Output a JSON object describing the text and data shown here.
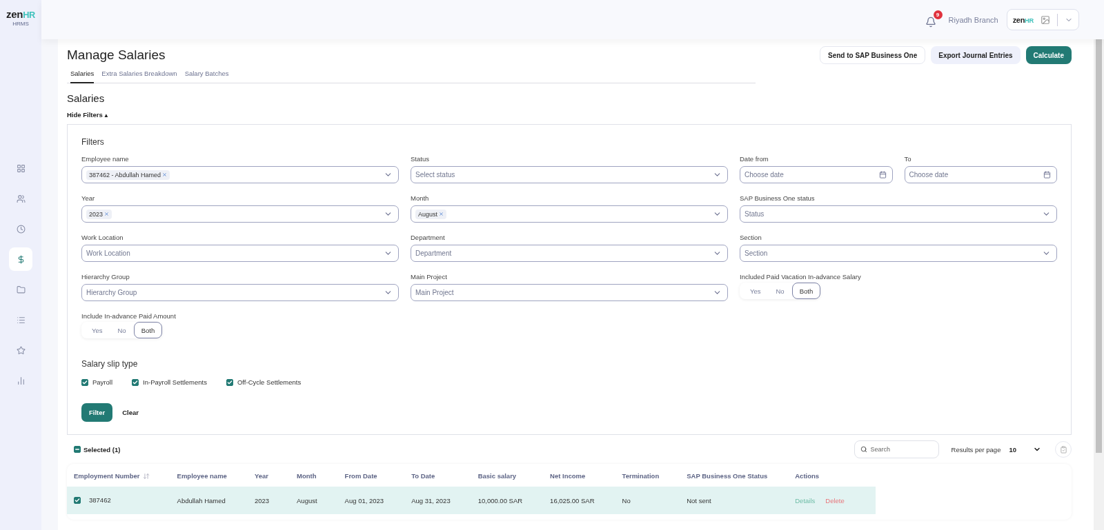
{
  "brand": {
    "logo_main": "zen",
    "logo_accent": "HR",
    "subtitle": "HRMS"
  },
  "sidebar": {
    "items": [
      {
        "kind": "grid",
        "selected": false
      },
      {
        "kind": "users",
        "selected": false
      },
      {
        "kind": "clock",
        "selected": false
      },
      {
        "kind": "dollar",
        "selected": true
      },
      {
        "kind": "folder",
        "selected": false
      },
      {
        "kind": "list",
        "selected": false
      },
      {
        "kind": "star",
        "selected": false
      },
      {
        "kind": "chart",
        "selected": false
      }
    ]
  },
  "header": {
    "notifications": "9",
    "branch": "Riyadh Branch",
    "company_logo": {
      "main": "zen",
      "accent": "HR"
    }
  },
  "page": {
    "title": "Manage Salaries",
    "actions": [
      {
        "label": "Send to SAP Business One",
        "kind": "outline"
      },
      {
        "label": "Export Journal Entries",
        "kind": "soft"
      },
      {
        "label": "Calculate",
        "kind": "primary"
      }
    ]
  },
  "tabs": [
    {
      "label": "Salaries",
      "selected": true
    },
    {
      "label": "Extra Salaries Breakdown",
      "selected": false
    },
    {
      "label": "Salary Batches",
      "selected": false
    }
  ],
  "section_title": "Salaries",
  "filters_toggle": {
    "label": "Hide Filters",
    "icon": "▴"
  },
  "filters": {
    "title": "Filters",
    "fields": [
      {
        "label": "Employee name",
        "kind": "multiselect",
        "tags": [
          "387462 - Abdullah Hamed"
        ]
      },
      {
        "label": "Status",
        "kind": "select",
        "placeholder": "Select status"
      },
      {
        "label": "Date from",
        "kind": "date",
        "placeholder": "Choose date"
      },
      {
        "label": "To",
        "kind": "date",
        "placeholder": "Choose date"
      },
      {
        "label": "Year",
        "kind": "multiselect",
        "tags": [
          "2023"
        ]
      },
      {
        "label": "Month",
        "kind": "multiselect",
        "tags": [
          "August"
        ]
      },
      {
        "label": "SAP Business One status",
        "kind": "select",
        "placeholder": "Status"
      },
      {
        "label": "Work Location",
        "kind": "select",
        "placeholder": "Work Location"
      },
      {
        "label": "Department",
        "kind": "select",
        "placeholder": "Department"
      },
      {
        "label": "Section",
        "kind": "select",
        "placeholder": "Section"
      },
      {
        "label": "Hierarchy Group",
        "kind": "select",
        "placeholder": "Hierarchy Group"
      },
      {
        "label": "Main Project",
        "kind": "select",
        "placeholder": "Main Project"
      },
      {
        "label": "Included Paid Vacation In-advance Salary",
        "kind": "toggle",
        "options": [
          {
            "label": "Yes",
            "selected": false
          },
          {
            "label": "No",
            "selected": false
          },
          {
            "label": "Both",
            "selected": true
          }
        ]
      },
      {
        "label": "Include In-advance Paid Amount",
        "kind": "toggle",
        "options": [
          {
            "label": "Yes",
            "selected": false
          },
          {
            "label": "No",
            "selected": false
          },
          {
            "label": "Both",
            "selected": true
          }
        ]
      }
    ],
    "slip_type": {
      "title": "Salary slip type",
      "options": [
        {
          "label": "Payroll",
          "checked": true
        },
        {
          "label": "In-Payroll Settlements",
          "checked": true
        },
        {
          "label": "Off-Cycle Settlements",
          "checked": true
        }
      ]
    },
    "buttons": [
      {
        "label": "Filter",
        "kind": "primary"
      },
      {
        "label": "Clear",
        "kind": "text"
      }
    ]
  },
  "table_toolbar": {
    "partial_selection": true,
    "selected_label": "Selected (1)",
    "search_placeholder": "Search",
    "results_label": "Results per page",
    "results_value": "10"
  },
  "table": {
    "columns": [
      {
        "label": "Employment Number",
        "sortable": true
      },
      {
        "label": "Employee name",
        "sortable": false
      },
      {
        "label": "Year",
        "sortable": false
      },
      {
        "label": "Month",
        "sortable": false
      },
      {
        "label": "From Date",
        "sortable": false
      },
      {
        "label": "To Date",
        "sortable": false
      },
      {
        "label": "Basic salary",
        "sortable": false
      },
      {
        "label": "Net Income",
        "sortable": false
      },
      {
        "label": "Termination",
        "sortable": false
      },
      {
        "label": "SAP Business One Status",
        "sortable": false
      },
      {
        "label": "Actions",
        "sortable": false
      }
    ],
    "rows": [
      {
        "selected": true,
        "cells": [
          "387462",
          "Abdullah Hamed",
          "2023",
          "August",
          "Aug 01, 2023",
          "Aug 31, 2023",
          "10,000.00 SAR",
          "16,025.00 SAR",
          "No",
          "Not sent"
        ],
        "actions": [
          {
            "label": "Details",
            "kind": "details"
          },
          {
            "label": "Delete",
            "kind": "delete"
          }
        ]
      }
    ]
  }
}
